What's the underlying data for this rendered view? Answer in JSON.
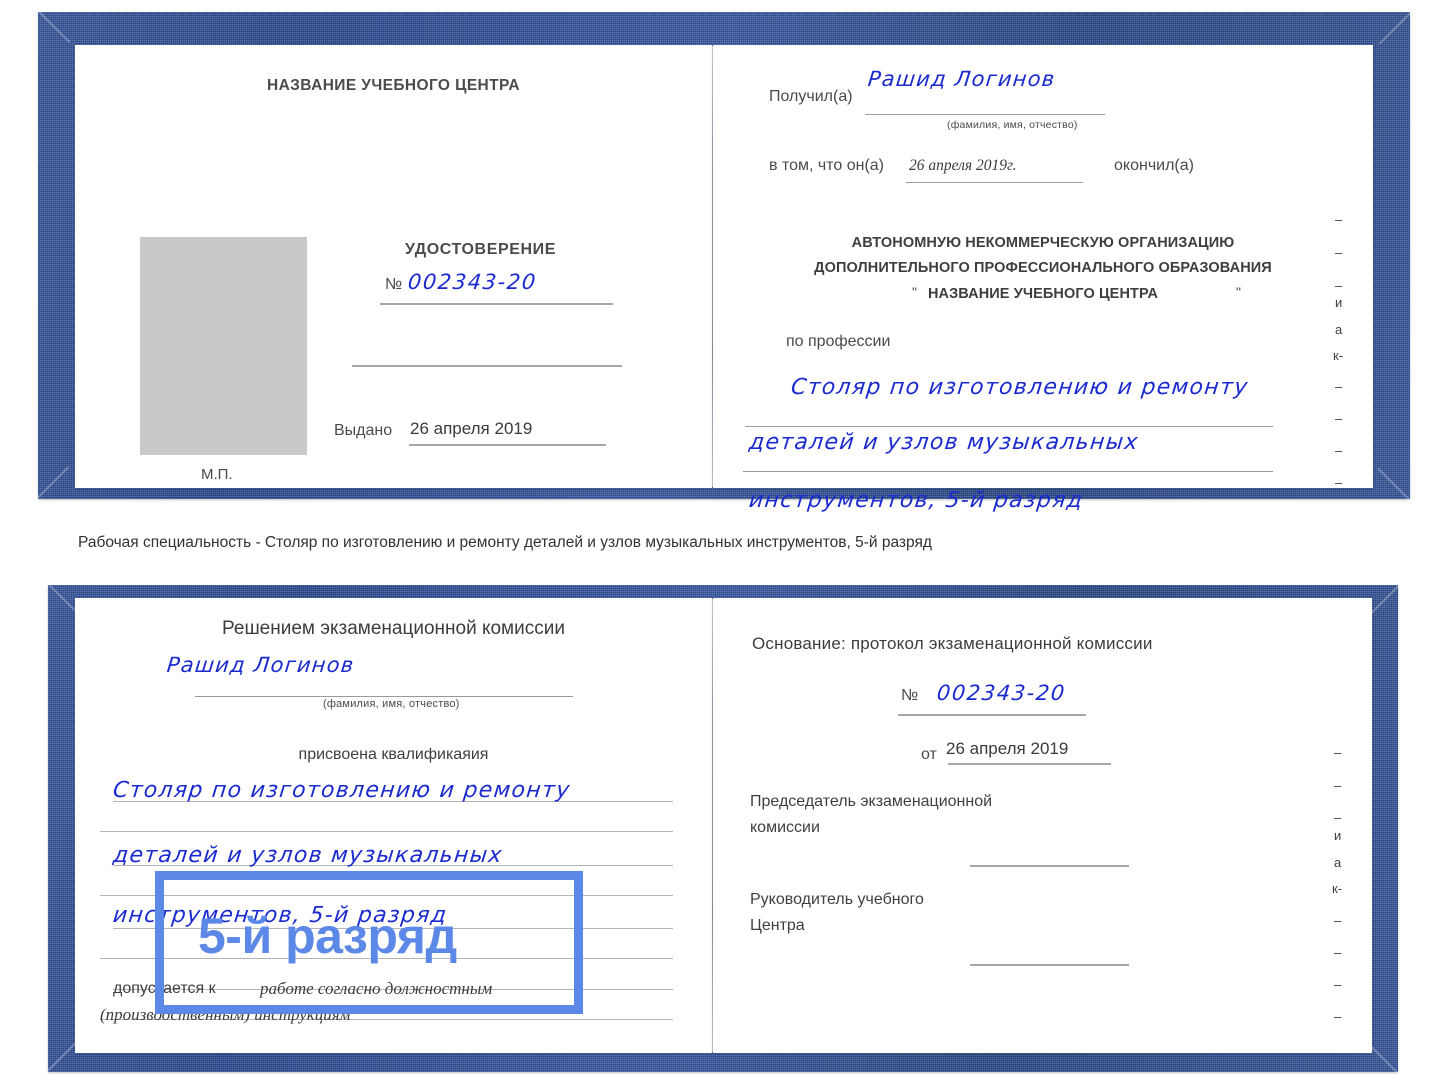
{
  "document": {
    "type": "Russian vocational qualification certificate (удостоверение), open booklet, two spreads",
    "cover_color": "#2b4a8f",
    "ink_color": "#1b2bcf",
    "highlight_color": "#5c88e8"
  },
  "top_spread": {
    "left_page": {
      "title": "НАЗВАНИЕ УЧЕБНОГО ЦЕНТРА",
      "doc_word": "УДОСТОВЕРЕНИЕ",
      "number_symbol": "№",
      "number_value": "002343-20",
      "issued_label": "Выдано",
      "issued_value": "26 апреля 2019",
      "seal_label": "М.П.",
      "photo_placeholder": "photo-area"
    },
    "right_page": {
      "received_label": "Получил(а)",
      "received_value": "Рашид Логинов",
      "fio_hint": "(фамилия, имя, отчество)",
      "in_that_label": "в том, что он(а)",
      "in_that_value": "26 апреля 2019г.",
      "finished_label": "окончил(а)",
      "org_line1": "АВТОНОМНУЮ НЕКОММЕРЧЕСКУЮ ОРГАНИЗАЦИЮ",
      "org_line2": "ДОПОЛНИТЕЛЬНОГО ПРОФЕССИОНАЛЬНОГО ОБРАЗОВАНИЯ",
      "org_quote_open": "\"",
      "org_line3": "НАЗВАНИЕ УЧЕБНОГО ЦЕНТРА",
      "org_quote_close": "\"",
      "profession_label": "по профессии",
      "profession_line1": "Столяр по изготовлению и ремонту",
      "profession_line2": "деталей и узлов музыкальных",
      "profession_line3": "инструментов, 5-й разряд",
      "edge_fragments": [
        "–",
        "–",
        "–",
        "и",
        "а",
        "к-",
        "–",
        "–",
        "–",
        "–"
      ]
    }
  },
  "caption": {
    "text": "Рабочая специальность - Столяр по изготовлению и ремонту деталей и узлов музыкальных инструментов, 5-й разряд"
  },
  "bottom_spread": {
    "left_page": {
      "title": "Решением экзаменационной комиссии",
      "name_value": "Рашид Логинов",
      "fio_hint": "(фамилия, имя, отчество)",
      "qualification_label": "присвоена квалификаяия",
      "qualification_line1": "Столяр по изготовлению и ремонту",
      "qualification_line2": "деталей и узлов музыкальных",
      "qualification_line3": "инструментов, 5-й разряд",
      "allowed_label": "допускается к",
      "allowed_value_line1": "работе согласно должностным",
      "allowed_value_line2": "(производственным) инструкциям"
    },
    "right_page": {
      "basis_label": "Основание: протокол экзаменационной комиссии",
      "number_symbol": "№",
      "number_value": "002343-20",
      "from_label": "от",
      "from_value": "26 апреля 2019",
      "chairman_line1": "Председатель экзаменационной",
      "chairman_line2": "комиссии",
      "head_line1": "Руководитель учебного",
      "head_line2": "Центра",
      "edge_fragments": [
        "–",
        "–",
        "–",
        "и",
        "а",
        "к-",
        "–",
        "–",
        "–",
        "–"
      ]
    }
  },
  "annotation": {
    "highlight_text": "5-й разряд",
    "highlight_color": "#5c88e8"
  }
}
